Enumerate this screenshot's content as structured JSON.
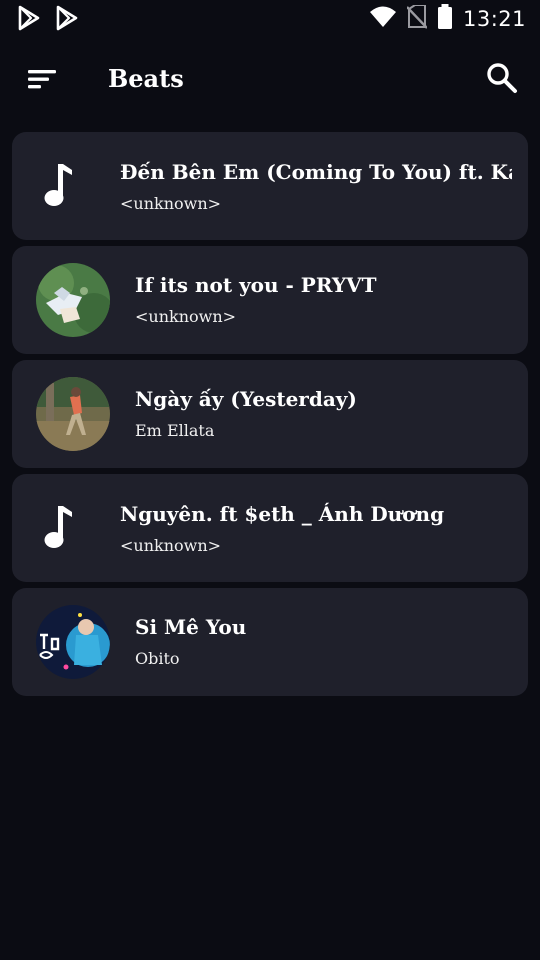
{
  "status_bar": {
    "time": "13:21",
    "left_icons": [
      "play-store-icon",
      "play-store-icon"
    ],
    "right_icons": [
      "wifi-icon",
      "no-sim-icon",
      "battery-icon"
    ]
  },
  "app_bar": {
    "title": "Beats",
    "menu_icon": "sort-menu-icon",
    "search_icon": "search-icon"
  },
  "tracks": [
    {
      "title": "Đến Bên Em (Coming To You) ft. Kai",
      "artist": "<unknown>",
      "art": "music-note-icon"
    },
    {
      "title": "If its not you - PRYVT",
      "artist": "<unknown>",
      "art": "album-art"
    },
    {
      "title": "Ngày ấy (Yesterday)",
      "artist": "Em Ellata",
      "art": "album-art"
    },
    {
      "title": "Nguyên. ft $eth _ Ánh Dương",
      "artist": "<unknown>",
      "art": "music-note-icon"
    },
    {
      "title": "Si Mê You",
      "artist": "Obito",
      "art": "album-art"
    }
  ],
  "colors": {
    "background": "#0b0c13",
    "card": "#1f202b",
    "text": "#ffffff"
  }
}
